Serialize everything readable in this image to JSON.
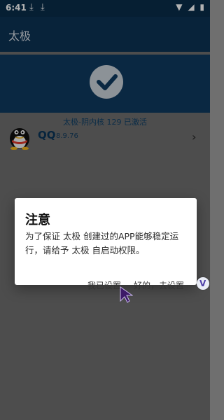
{
  "status_bar": {
    "time": "6:41",
    "download_icon": "download-arrow-icon",
    "wifi_icon": "wifi-icon",
    "signal_icon": "cell-signal-icon",
    "battery_icon": "battery-icon"
  },
  "app_bar": {
    "title": "太极"
  },
  "hero": {
    "icon": "check-circle-icon"
  },
  "activation_text": "太极-阴内核 129 已激活",
  "module": {
    "icon": "qq-penguin-icon",
    "name": "QQ",
    "version": "8.9.76",
    "chevron_icon": "chevron-right-icon"
  },
  "dialog": {
    "title": "注意",
    "message": "为了保证 太极 创建过的APP能够稳定运行，请给予 太极 自启动权限。",
    "buttons": {
      "already": "我已设置",
      "ok": "好的，去设置"
    }
  },
  "bubble": {
    "icon": "bubble-v-icon",
    "letter": "V"
  },
  "colors": {
    "status_bar": "#0a2d4a",
    "app_bar": "#0c3353",
    "hero": "#0f3a5f",
    "accent": "#0f3f66",
    "overlay": "#6f6f6f"
  }
}
